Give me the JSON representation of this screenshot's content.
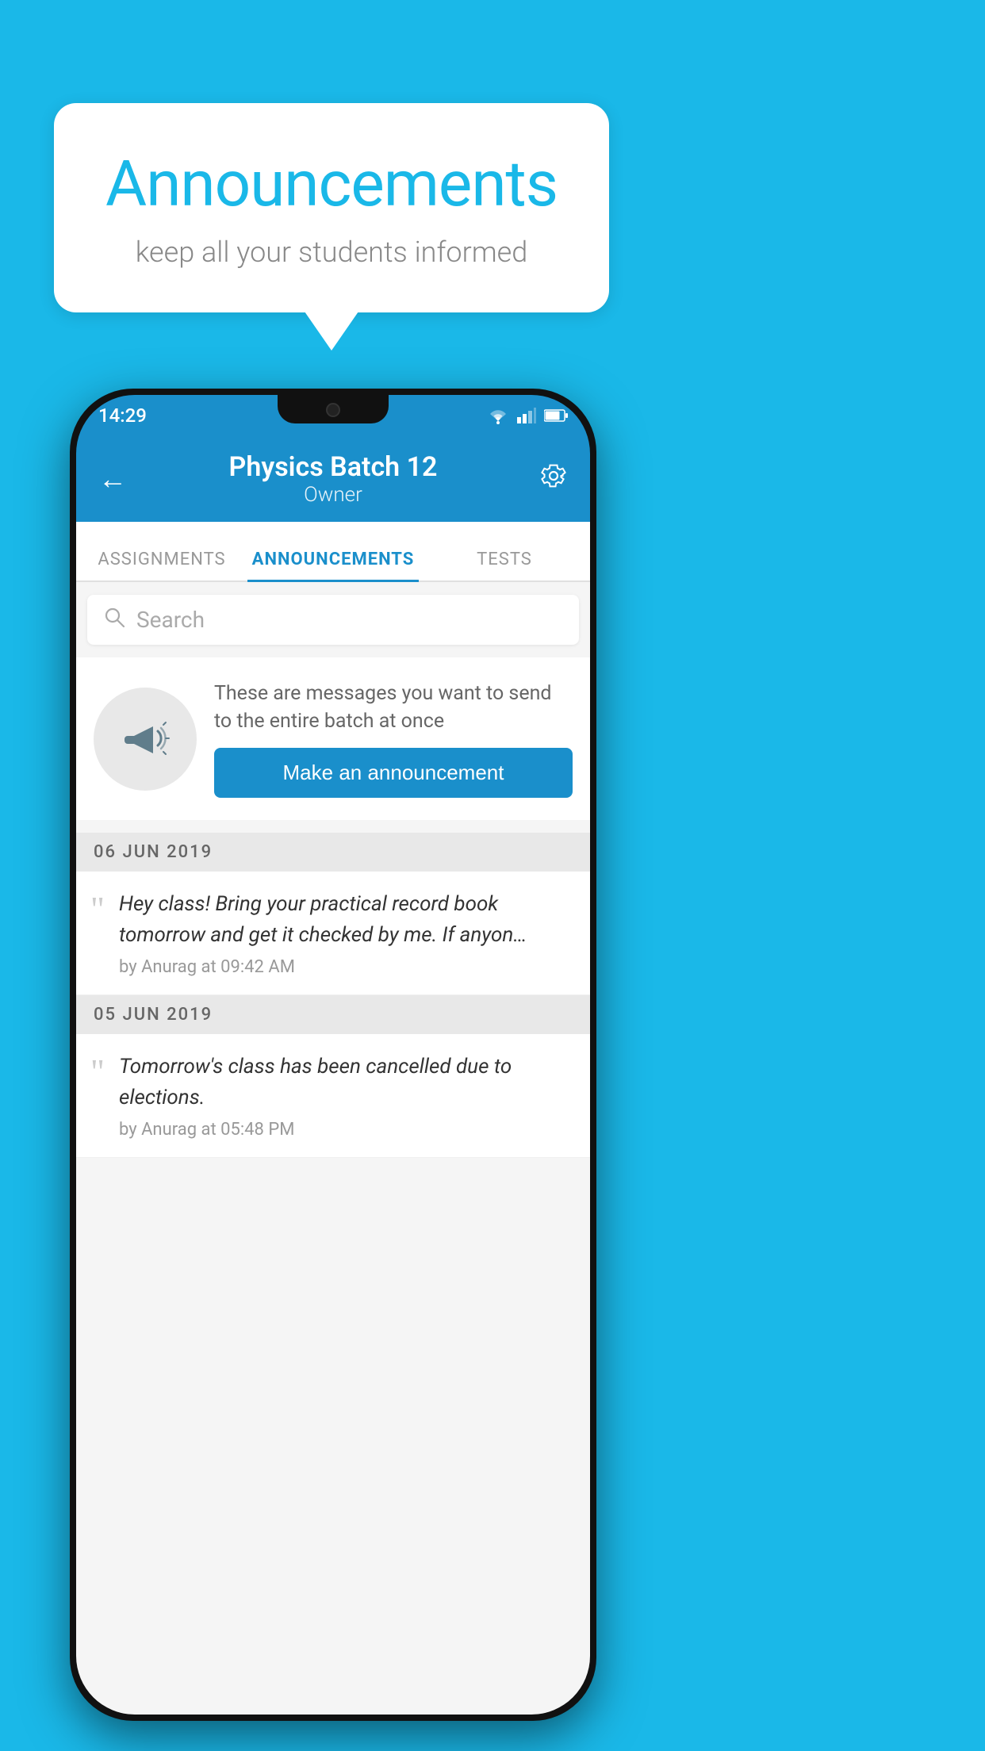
{
  "background_color": "#1ab8e8",
  "speech_bubble": {
    "title": "Announcements",
    "subtitle": "keep all your students informed"
  },
  "status_bar": {
    "time": "14:29"
  },
  "app_bar": {
    "title": "Physics Batch 12",
    "subtitle": "Owner",
    "back_label": "←",
    "gear_label": "⚙"
  },
  "tabs": [
    {
      "label": "ASSIGNMENTS",
      "active": false
    },
    {
      "label": "ANNOUNCEMENTS",
      "active": true
    },
    {
      "label": "TESTS",
      "active": false
    }
  ],
  "search": {
    "placeholder": "Search"
  },
  "promo": {
    "description": "These are messages you want to send to the entire batch at once",
    "button_label": "Make an announcement"
  },
  "date_sections": [
    {
      "date": "06  JUN  2019",
      "items": [
        {
          "text": "Hey class! Bring your practical record book tomorrow and get it checked by me. If anyon…",
          "meta": "by Anurag at 09:42 AM"
        }
      ]
    },
    {
      "date": "05  JUN  2019",
      "items": [
        {
          "text": "Tomorrow's class has been cancelled due to elections.",
          "meta": "by Anurag at 05:48 PM"
        }
      ]
    }
  ]
}
